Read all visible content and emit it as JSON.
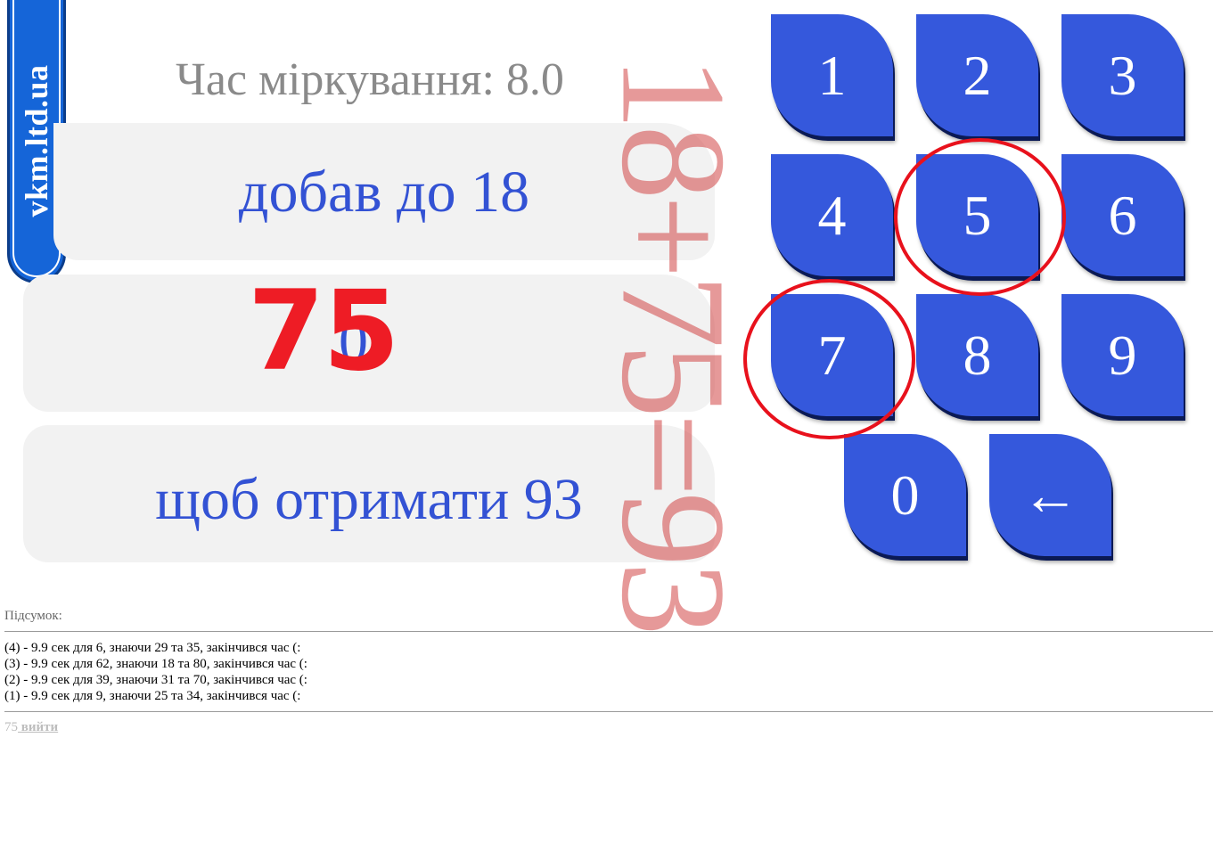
{
  "logo": {
    "text": "vkm.ltd.ua",
    "color": "#1565d8"
  },
  "timer": {
    "text": "Час міркування: 8.0"
  },
  "task": {
    "prompt": "добав до 18",
    "input_value": "0",
    "target": "щоб отримати 93"
  },
  "overlay": {
    "answer": "75",
    "equation": "18+75=93",
    "highlighted_keys": [
      "5",
      "7"
    ],
    "accent_color": "#ee1c25"
  },
  "keypad": {
    "keys": [
      "1",
      "2",
      "3",
      "4",
      "5",
      "6",
      "7",
      "8",
      "9",
      "0",
      "←"
    ],
    "key_color": "#3558dc"
  },
  "summary": {
    "label": "Підсумок:",
    "history": [
      "(4) - 9.9 сек для 6, знаючи 29 та 35, закінчився час (:",
      "(3) - 9.9 сек для 62, знаючи 18 та 80, закінчився час (:",
      "(2) - 9.9 сек для 39, знаючи 31 та 70, закінчився час (:",
      "(1) - 9.9 сек для 9, знаючи 25 та 34, закінчився час (:"
    ]
  },
  "footer": {
    "score": "75",
    "exit_label": " вийти"
  }
}
